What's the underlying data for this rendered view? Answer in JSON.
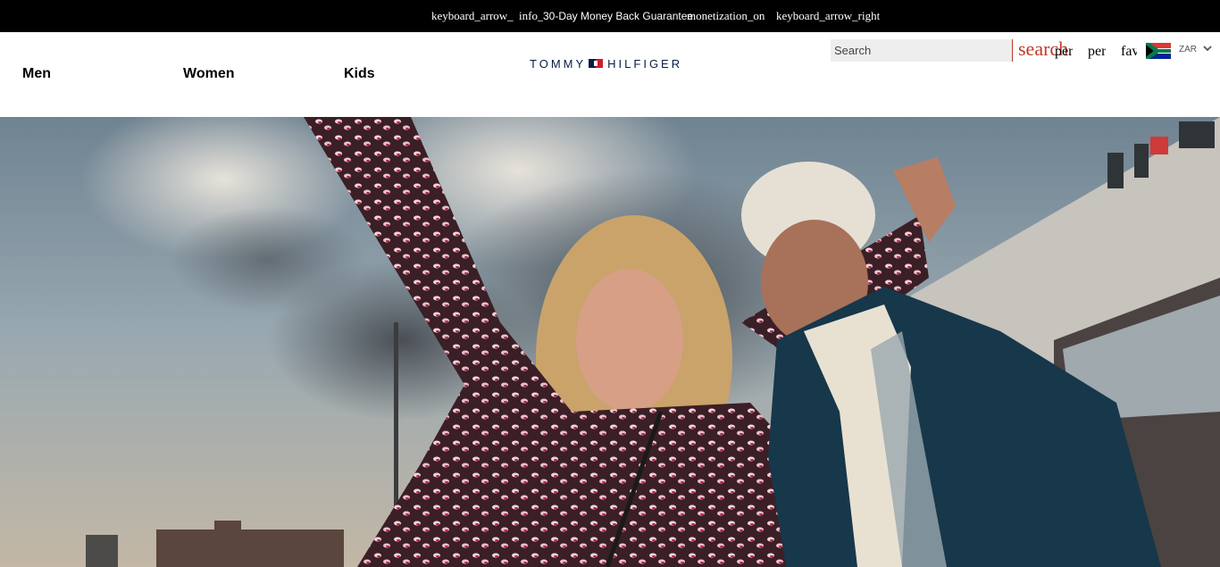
{
  "announcement": {
    "left_arrow_icon": "keyboard_arrow_left",
    "left_arrow_label": "keyboard_arrow_",
    "info_icon_label": "info_outline",
    "message": "30-Day Money Back Guarantee",
    "money_icon_label": "monetization_on",
    "right_arrow_label": "keyboard_arrow_right"
  },
  "nav": {
    "men": "Men",
    "women": "Women",
    "kids": "Kids"
  },
  "logo": {
    "left": "TOMMY",
    "right": "HILFIGER"
  },
  "search": {
    "placeholder": "Search",
    "icon_label": "search"
  },
  "utilities": {
    "person_label": "person",
    "person2_label": "person",
    "favorite_label": "favorite"
  },
  "currency": {
    "code": "ZAR",
    "flag_icon": "south-africa-flag-icon"
  },
  "hero": {
    "image": "hero-photo"
  },
  "colors": {
    "brand_navy": "#0b1c45",
    "brand_red": "#cc1e2f",
    "search_accent": "#c0392b"
  }
}
